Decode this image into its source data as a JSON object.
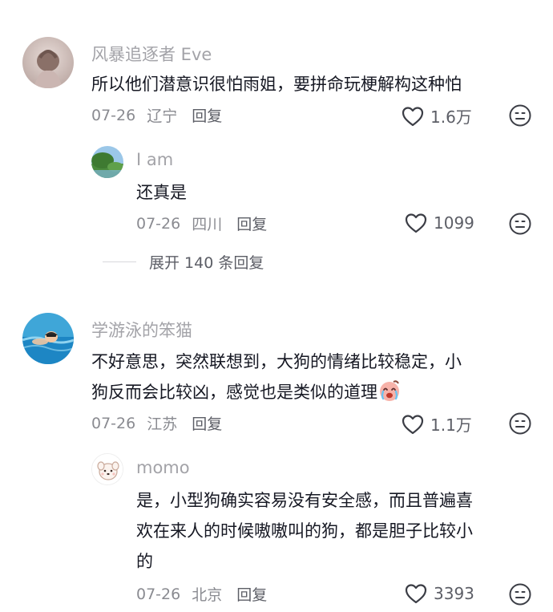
{
  "comments": [
    {
      "user": "风暴追逐者 Eve",
      "text": "所以他们潜意识很怕雨姐，要拼命玩梗解构这种怕",
      "date": "07-26",
      "location": "辽宁",
      "reply_label": "回复",
      "likes": "1.6万",
      "replies": [
        {
          "user": "I am",
          "text": "还真是",
          "date": "07-26",
          "location": "四川",
          "reply_label": "回复",
          "likes": "1099"
        }
      ],
      "expand_label": "展开 140 条回复"
    },
    {
      "user": "学游泳的笨猫",
      "text_line1": "不好意思，突然联想到，大狗的情绪比较稳定，小",
      "text_line2": "狗反而会比较凶，感觉也是类似的道理",
      "date": "07-26",
      "location": "江苏",
      "reply_label": "回复",
      "likes": "1.1万",
      "replies": [
        {
          "user": "momo",
          "text_line1": "是，小型狗确实容易没有安全感，而且普遍喜",
          "text_line2": "欢在来人的时候嗷嗷叫的狗，都是胆子比较小",
          "text_line3": "的",
          "date": "07-26",
          "location": "北京",
          "reply_label": "回复",
          "likes": "3393"
        }
      ]
    }
  ],
  "icons": {
    "like": "heart-outline-icon",
    "dislike": "meh-face-icon",
    "emoji": "crying-laugh-emoji"
  },
  "colors": {
    "text": "#161823",
    "secondary": "#a3a3a8",
    "meta": "#8a8b91"
  }
}
